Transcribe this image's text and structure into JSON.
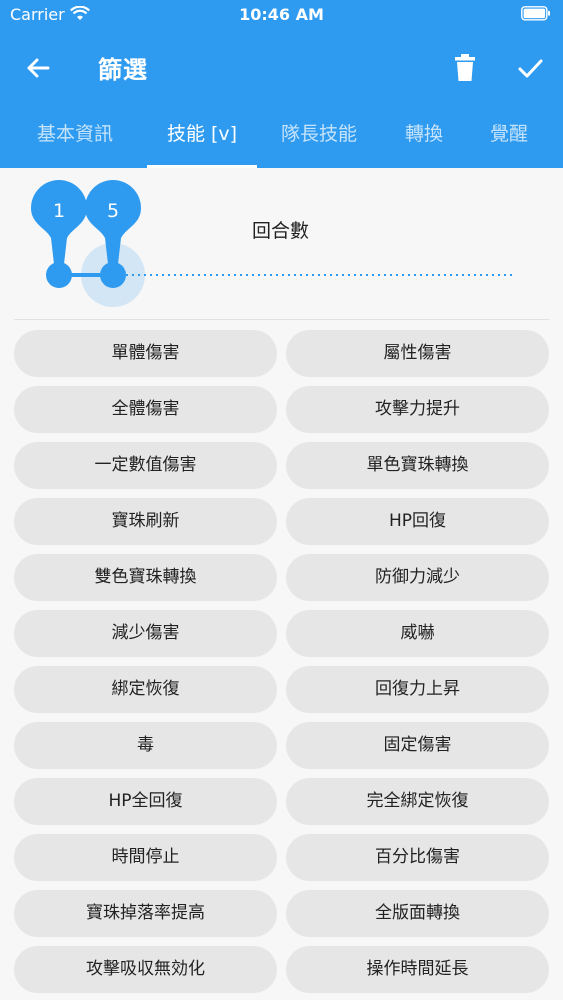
{
  "status": {
    "carrier": "Carrier",
    "time": "10:46 AM"
  },
  "toolbar": {
    "title": "篩選"
  },
  "tabs": [
    {
      "label": "基本資訊",
      "active": false
    },
    {
      "label": "技能 [v]",
      "active": true
    },
    {
      "label": "隊長技能",
      "active": false
    },
    {
      "label": "轉換",
      "active": false
    },
    {
      "label": "覺醒",
      "active": false
    }
  ],
  "slider": {
    "label": "回合數",
    "min_thumb": "1",
    "max_thumb": "5",
    "range_min": 1,
    "range_max": 5
  },
  "chips": [
    "單體傷害",
    "屬性傷害",
    "全體傷害",
    "攻擊力提升",
    "一定數值傷害",
    "單色寶珠轉換",
    "寶珠刷新",
    "HP回復",
    "雙色寶珠轉換",
    "防御力減少",
    "減少傷害",
    "威嚇",
    "綁定恢復",
    "回復力上昇",
    "毒",
    "固定傷害",
    "HP全回復",
    "完全綁定恢復",
    "時間停止",
    "百分比傷害",
    "寶珠掉落率提高",
    "全版面轉換",
    "攻擊吸収無効化",
    "操作時間延長"
  ],
  "colors": {
    "primary": "#2f9bf0",
    "chip_bg": "#e6e6e6",
    "background": "#f7f7f7"
  },
  "icons": {
    "back": "arrow-left-icon",
    "delete": "trash-icon",
    "confirm": "check-icon"
  }
}
